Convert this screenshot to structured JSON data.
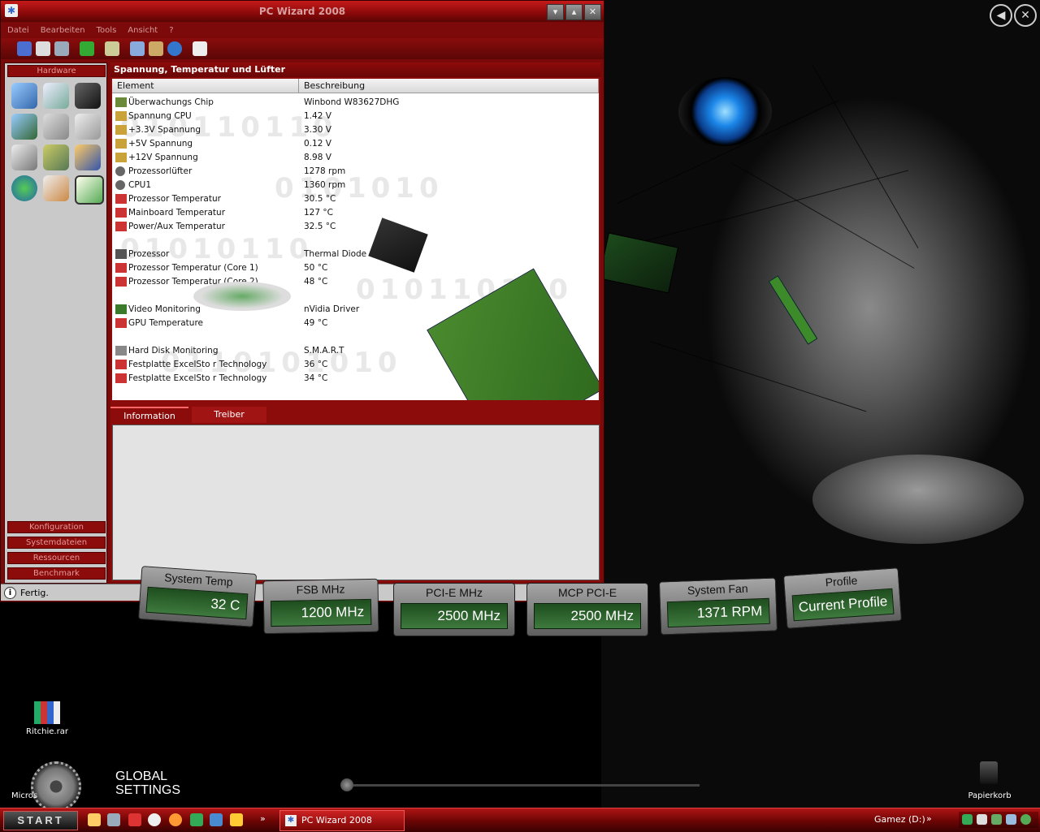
{
  "window": {
    "title": "PC Wizard 2008",
    "minimize": "▾",
    "restore": "▴",
    "close": "✕"
  },
  "menu": [
    "Datei",
    "Bearbeiten",
    "Tools",
    "Ansicht",
    "?"
  ],
  "left_panel": {
    "header": "Hardware",
    "sections": [
      "Konfiguration",
      "Systemdateien",
      "Ressourcen",
      "Benchmark"
    ]
  },
  "panel_title": "Spannung, Temperatur und Lüfter",
  "columns": [
    "Element",
    "Beschreibung"
  ],
  "rows": [
    {
      "el": "Überwachungs Chip",
      "de": "Winbond W83627DHG",
      "icon": "chip-icon"
    },
    {
      "el": "Spannung CPU",
      "de": "1.42 V",
      "icon": "voltage-icon"
    },
    {
      "el": "+3.3V Spannung",
      "de": "3.30 V",
      "icon": "voltage-icon"
    },
    {
      "el": "+5V Spannung",
      "de": "0.12 V",
      "icon": "voltage-icon"
    },
    {
      "el": "+12V Spannung",
      "de": "8.98 V",
      "icon": "voltage-icon"
    },
    {
      "el": "Prozessorlüfter",
      "de": "1278 rpm",
      "icon": "fan-icon"
    },
    {
      "el": "CPU1",
      "de": "1360 rpm",
      "icon": "fan-icon"
    },
    {
      "el": "Prozessor Temperatur",
      "de": "30.5 °C",
      "icon": "thermometer-icon"
    },
    {
      "el": "Mainboard Temperatur",
      "de": "127 °C",
      "icon": "thermometer-icon"
    },
    {
      "el": "Power/Aux Temperatur",
      "de": "32.5 °C",
      "icon": "thermometer-icon"
    },
    {
      "el": "",
      "de": "",
      "icon": ""
    },
    {
      "el": "Prozessor",
      "de": "Thermal Diode",
      "icon": "cpu-icon"
    },
    {
      "el": "Prozessor Temperatur (Core 1)",
      "de": "50 °C",
      "icon": "thermometer-icon"
    },
    {
      "el": "Prozessor Temperatur (Core 2)",
      "de": "48 °C",
      "icon": "thermometer-icon"
    },
    {
      "el": "",
      "de": "",
      "icon": ""
    },
    {
      "el": "Video Monitoring",
      "de": "nVidia Driver",
      "icon": "video-card-icon"
    },
    {
      "el": "GPU Temperature",
      "de": "49 °C",
      "icon": "thermometer-icon"
    },
    {
      "el": "",
      "de": "",
      "icon": ""
    },
    {
      "el": "Hard Disk Monitoring",
      "de": "S.M.A.R.T",
      "icon": "hard-disk-icon"
    },
    {
      "el": "Festplatte ExcelSto r Technology",
      "de": "36 °C",
      "icon": "thermometer-icon"
    },
    {
      "el": "Festplatte ExcelSto r Technology",
      "de": "34 °C",
      "icon": "thermometer-icon"
    }
  ],
  "tabs": [
    "Information",
    "Treiber"
  ],
  "status": "Fertig.",
  "widgets": [
    {
      "label": "System Temp",
      "value": "32 C"
    },
    {
      "label": "FSB MHz",
      "value": "1200 MHz"
    },
    {
      "label": "PCI-E MHz",
      "value": "2500 MHz"
    },
    {
      "label": "MCP PCI-E",
      "value": "2500 MHz"
    },
    {
      "label": "System Fan",
      "value": "1371 RPM"
    },
    {
      "label": "Profile",
      "value": "Current Profile"
    }
  ],
  "global_settings": [
    "GLOBAL",
    "SETTINGS"
  ],
  "global_settings_caption": "Micros",
  "desktop": {
    "rar_label": "Ritchie.rar",
    "recycle_label": "Papierkorb"
  },
  "taskbar": {
    "start": "START",
    "task": "PC Wizard 2008",
    "toolbar": "Gamez (D:)",
    "more": "»"
  },
  "colors": {
    "accent": "#8c0b0b",
    "title_bar": "#c61a1a",
    "gauge_green": "#2e6a2e"
  }
}
